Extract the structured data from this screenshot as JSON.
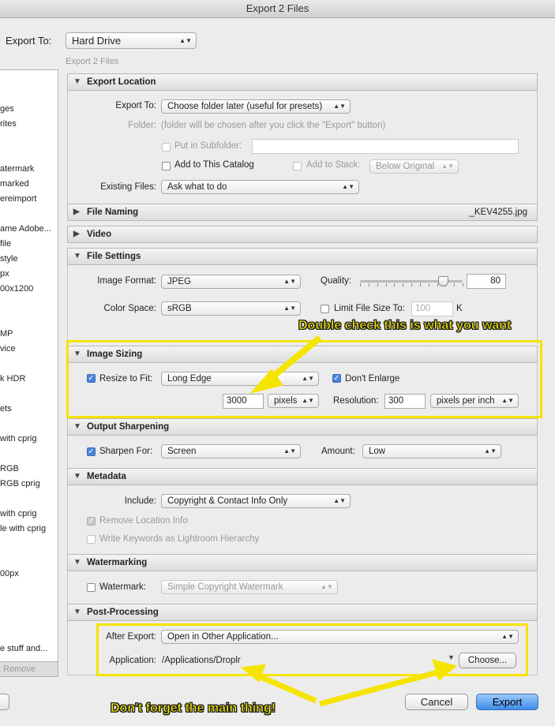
{
  "window": {
    "title": "Export 2 Files"
  },
  "header": {
    "export_to_label": "Export To:",
    "export_to_value": "Hard Drive",
    "subtitle": "Export 2 Files"
  },
  "sidebar": {
    "items": [
      "ges",
      "rites",
      "atermark",
      "marked",
      "ereimport",
      "ame Adobe...",
      "file",
      "style",
      "px",
      "00x1200",
      "MP",
      "vice",
      "k HDR",
      "ets",
      "with cprig",
      "RGB",
      "RGB cprig",
      "with cprig",
      "le with cprig",
      "00px",
      "e stuff and..."
    ],
    "remove_label": "Remove"
  },
  "export_location": {
    "title": "Export Location",
    "export_to_label": "Export To:",
    "export_to_value": "Choose folder later (useful for presets)",
    "folder_label": "Folder:",
    "folder_value": "(folder will be chosen after you click the \"Export\" button)",
    "subfolder_label": "Put in Subfolder:",
    "add_catalog_label": "Add to This Catalog",
    "add_stack_label": "Add to Stack:",
    "stack_value": "Below Original",
    "existing_label": "Existing Files:",
    "existing_value": "Ask what to do"
  },
  "file_naming": {
    "title": "File Naming",
    "example": "_KEV4255.jpg"
  },
  "video": {
    "title": "Video"
  },
  "file_settings": {
    "title": "File Settings",
    "format_label": "Image Format:",
    "format_value": "JPEG",
    "quality_label": "Quality:",
    "quality_value": "80",
    "quality_fraction": 0.8,
    "colorspace_label": "Color Space:",
    "colorspace_value": "sRGB",
    "limit_label": "Limit File Size To:",
    "limit_value": "100",
    "limit_unit": "K"
  },
  "image_sizing": {
    "title": "Image Sizing",
    "resize_label": "Resize to Fit:",
    "resize_value": "Long Edge",
    "dont_enlarge_label": "Don't Enlarge",
    "size_value": "3000",
    "size_unit": "pixels",
    "resolution_label": "Resolution:",
    "resolution_value": "300",
    "resolution_unit": "pixels per inch"
  },
  "output_sharpening": {
    "title": "Output Sharpening",
    "sharpen_label": "Sharpen For:",
    "sharpen_value": "Screen",
    "amount_label": "Amount:",
    "amount_value": "Low"
  },
  "metadata": {
    "title": "Metadata",
    "include_label": "Include:",
    "include_value": "Copyright & Contact Info Only",
    "remove_location_label": "Remove Location Info",
    "write_keywords_label": "Write Keywords as Lightroom Hierarchy"
  },
  "watermarking": {
    "title": "Watermarking",
    "watermark_label": "Watermark:",
    "watermark_value": "Simple Copyright Watermark"
  },
  "post_processing": {
    "title": "Post-Processing",
    "after_label": "After Export:",
    "after_value": "Open in Other Application...",
    "app_label": "Application:",
    "app_value": "/Applications/Droplr",
    "choose_label": "Choose..."
  },
  "footer": {
    "cancel_label": "Cancel",
    "export_label": "Export"
  },
  "annotations": {
    "top": "Double check this is what you want",
    "bottom": "Don't forget the main thing!"
  },
  "colors": {
    "highlight": "#f5e400",
    "primary_button": "#3d8be8"
  }
}
